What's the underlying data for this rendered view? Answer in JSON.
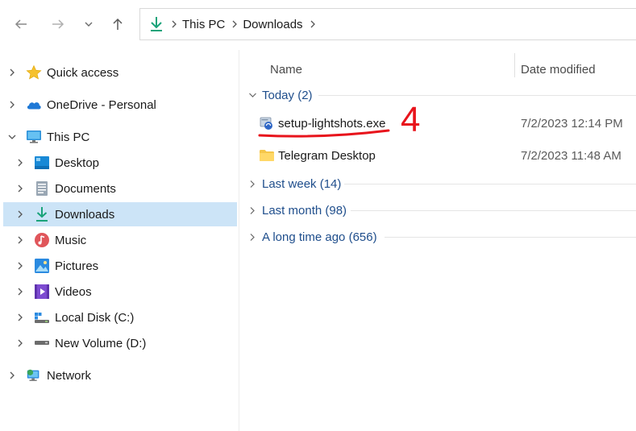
{
  "window": {
    "breadcrumb": [
      "This PC",
      "Downloads"
    ]
  },
  "nav": {
    "items": [
      {
        "label": "Quick access",
        "icon": "star-icon",
        "level": 0,
        "expanded": false
      },
      {
        "label": "OneDrive - Personal",
        "icon": "cloud-icon",
        "level": 0,
        "expanded": false
      },
      {
        "label": "This PC",
        "icon": "monitor-icon",
        "level": 0,
        "expanded": true
      },
      {
        "label": "Desktop",
        "icon": "desktop-icon",
        "level": 1,
        "expanded": false
      },
      {
        "label": "Documents",
        "icon": "document-icon",
        "level": 1,
        "expanded": false
      },
      {
        "label": "Downloads",
        "icon": "download-icon",
        "level": 1,
        "expanded": false,
        "selected": true
      },
      {
        "label": "Music",
        "icon": "music-icon",
        "level": 1,
        "expanded": false
      },
      {
        "label": "Pictures",
        "icon": "pictures-icon",
        "level": 1,
        "expanded": false
      },
      {
        "label": "Videos",
        "icon": "videos-icon",
        "level": 1,
        "expanded": false
      },
      {
        "label": "Local Disk (C:)",
        "icon": "drive-icon",
        "level": 1,
        "expanded": false
      },
      {
        "label": "New Volume (D:)",
        "icon": "drive-icon",
        "level": 1,
        "expanded": false
      },
      {
        "label": "Network",
        "icon": "network-icon",
        "level": 0,
        "expanded": false
      }
    ]
  },
  "columns": {
    "name": "Name",
    "date_modified": "Date modified"
  },
  "groups": {
    "today": {
      "label": "Today (2)",
      "expanded": true
    },
    "last_week": {
      "label": "Last week (14)",
      "expanded": false
    },
    "last_month": {
      "label": "Last month (98)",
      "expanded": false
    },
    "long_ago": {
      "label": "A long time ago (656)",
      "expanded": false
    }
  },
  "files": [
    {
      "name": "setup-lightshots.exe",
      "date": "7/2/2023 12:14 PM",
      "icon": "installer-icon"
    },
    {
      "name": "Telegram Desktop",
      "date": "7/2/2023 11:48 AM",
      "icon": "folder-icon"
    }
  ],
  "annotation": {
    "number": "4"
  },
  "colors": {
    "selection": "#cce4f7",
    "group_text": "#1f4e8c",
    "annotation": "#e8141c",
    "download_green": "#1aa37a"
  }
}
